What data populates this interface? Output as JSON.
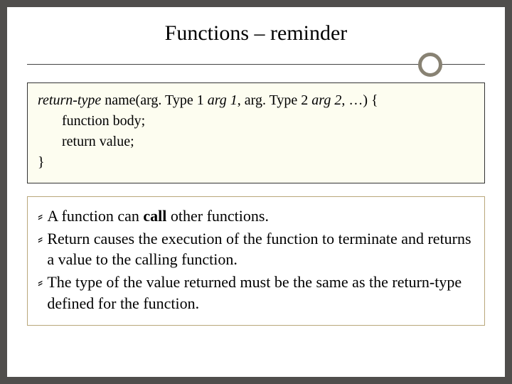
{
  "title": "Functions – reminder",
  "code": {
    "line1": {
      "returnType": "return-type",
      "nameOpen": " name(arg. Type 1 ",
      "arg1": " arg 1",
      "sep1": ",  arg. Type 2 ",
      "arg2": " arg 2",
      "close": ", …) {"
    },
    "line2": "function body;",
    "line3": "return value;",
    "line4": "}"
  },
  "bullets": [
    {
      "pre": "A function can ",
      "bold": "call",
      "post": " other functions."
    },
    {
      "text": "Return causes the execution of the function to terminate and returns a value to the calling function."
    },
    {
      "text": "The type of the value returned must be the same as the return-type defined for the function."
    }
  ],
  "bulletMark": "⸗"
}
